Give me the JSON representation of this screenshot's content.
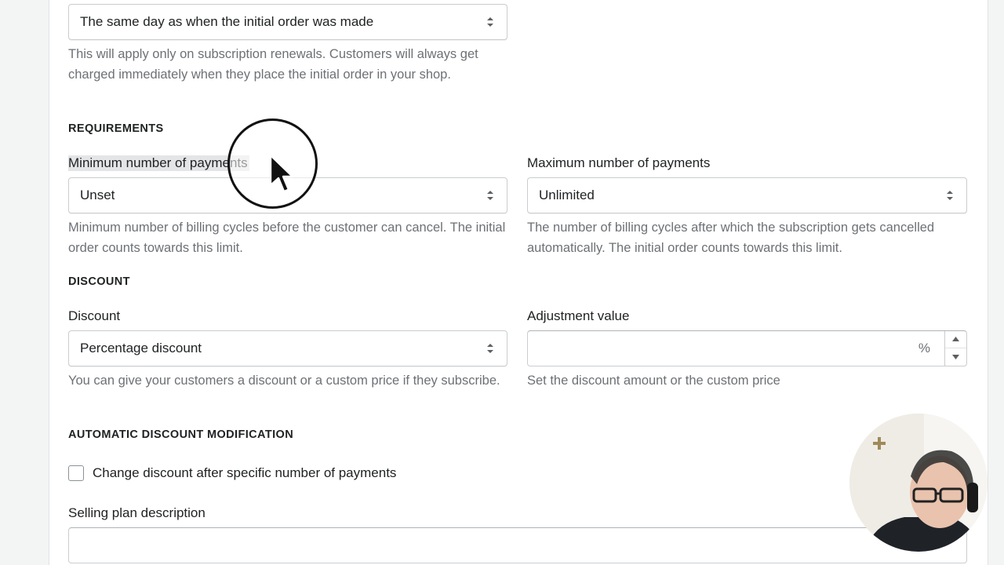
{
  "billing_day": {
    "select_value": "The same day as when the initial order was made",
    "help": "This will apply only on subscription renewals. Customers will always get charged immediately when they place the initial order in your shop."
  },
  "requirements": {
    "heading": "REQUIREMENTS",
    "min_label": "Minimum number of payments",
    "min_value": "Unset",
    "min_help": "Minimum number of billing cycles before the customer can cancel. The initial order counts towards this limit.",
    "max_label": "Maximum number of payments",
    "max_value": "Unlimited",
    "max_help": "The number of billing cycles after which the subscription gets cancelled automatically. The initial order counts towards this limit."
  },
  "discount": {
    "heading": "DISCOUNT",
    "type_label": "Discount",
    "type_value": "Percentage discount",
    "type_help": "You can give your customers a discount or a custom price if they subscribe.",
    "adjust_label": "Adjustment value",
    "adjust_value": "",
    "adjust_suffix": "%",
    "adjust_help": "Set the discount amount or the custom price"
  },
  "auto_discount": {
    "heading": "AUTOMATIC DISCOUNT MODIFICATION",
    "checkbox_label": "Change discount after specific number of payments",
    "checked": false
  },
  "description": {
    "label": "Selling plan description",
    "value": ""
  },
  "icons": {
    "select_caret": "updown-caret-icon",
    "cursor": "mouse-pointer-icon",
    "stepper_up": "caret-up-icon",
    "stepper_down": "caret-down-icon"
  },
  "colors": {
    "text": "#202223",
    "subdued": "#6d7175",
    "border": "#c9cccf",
    "background": "#f3f4f4"
  }
}
